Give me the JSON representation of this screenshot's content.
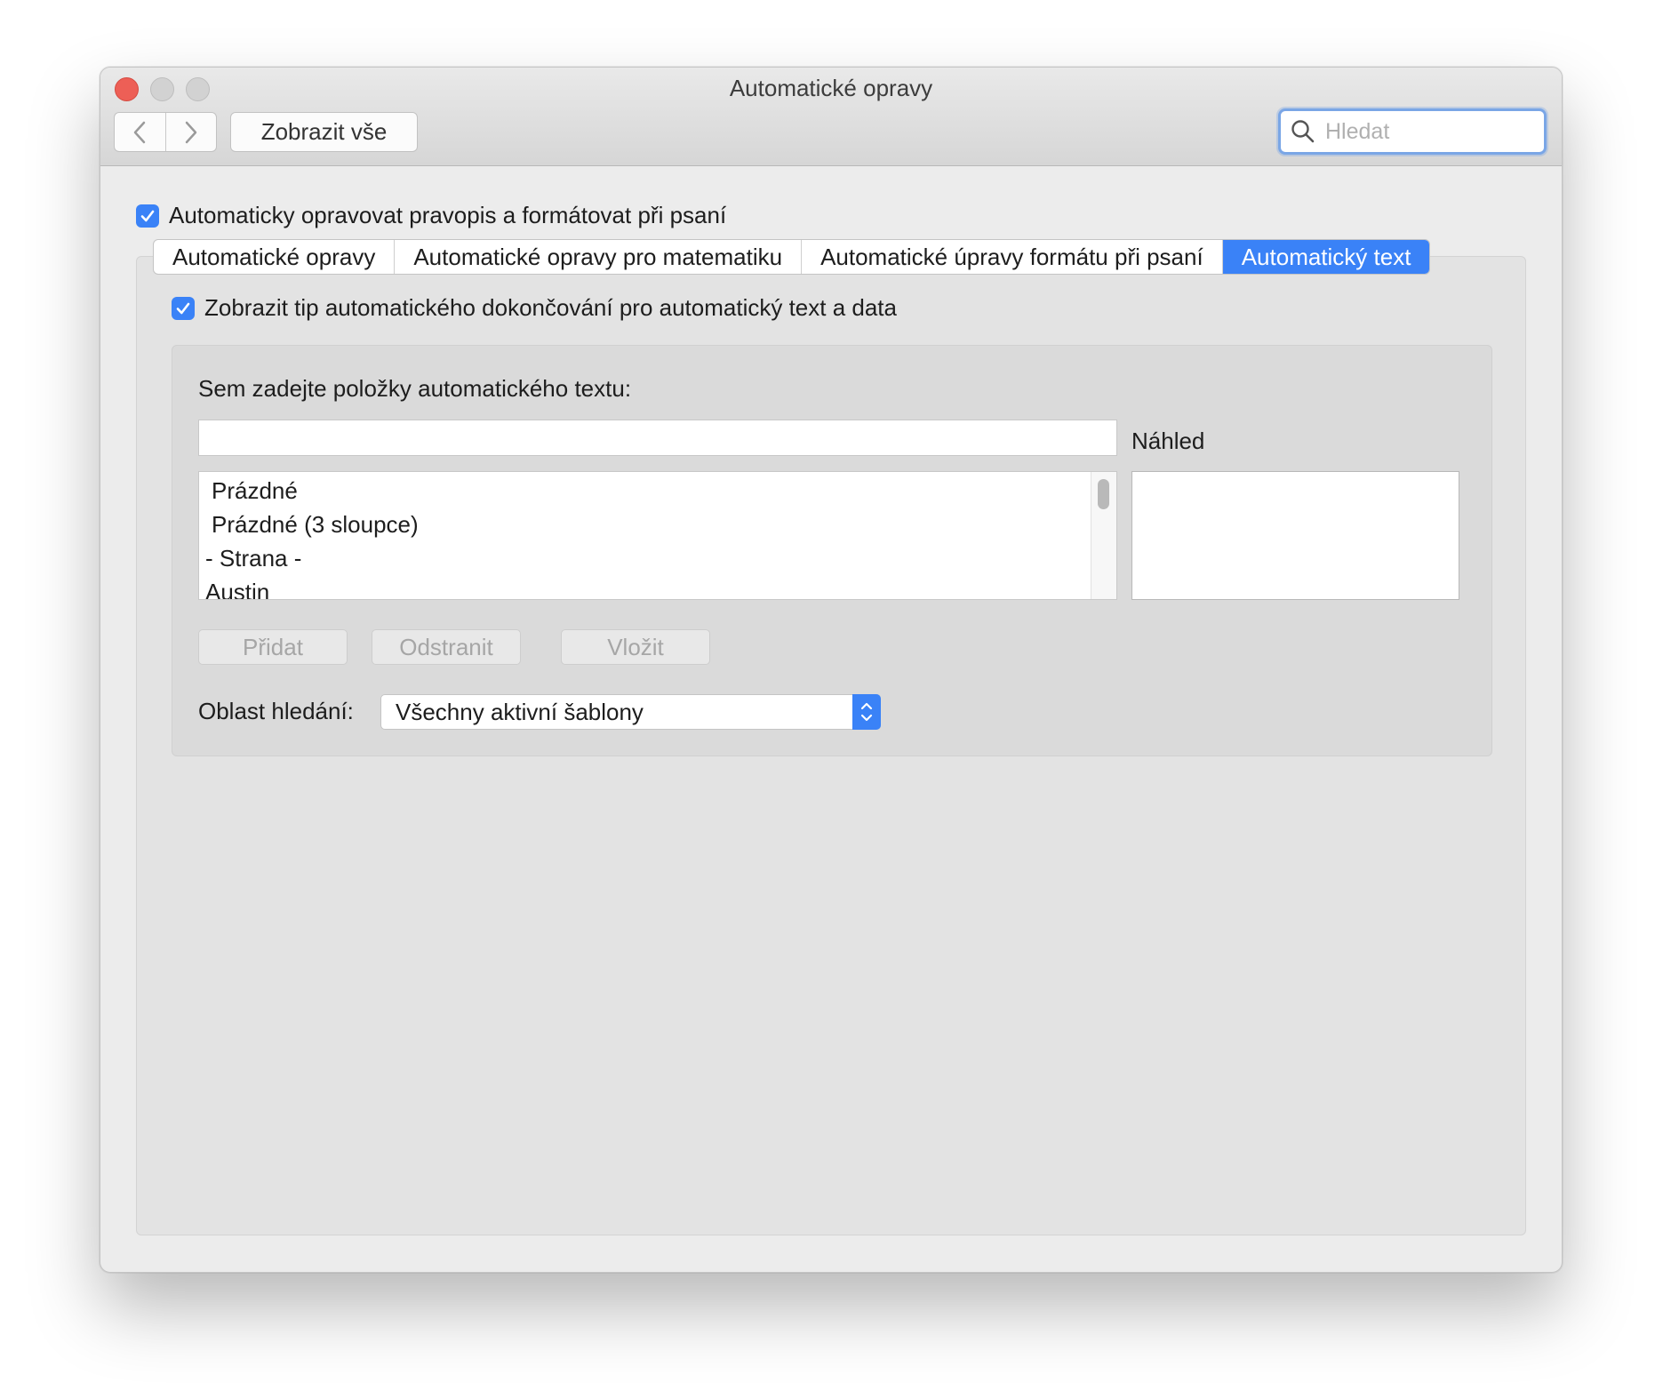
{
  "window": {
    "title": "Automatické opravy",
    "show_all_label": "Zobrazit vše",
    "search_placeholder": "Hledat"
  },
  "main": {
    "auto_correct_checkbox": {
      "label": "Automaticky opravovat pravopis a formátovat při psaní",
      "checked": true
    },
    "tabs": [
      {
        "label": "Automatické opravy",
        "active": false
      },
      {
        "label": "Automatické opravy pro matematiku",
        "active": false
      },
      {
        "label": "Automatické úpravy formátu při psaní",
        "active": false
      },
      {
        "label": "Automatický text",
        "active": true
      }
    ],
    "autocomplete_checkbox": {
      "label": "Zobrazit tip automatického dokončování pro automatický text a data",
      "checked": true
    },
    "entries_label": "Sem zadejte položky automatického textu:",
    "entry_value": "",
    "preview_label": "Náhled",
    "list_items": [
      "Prázdné",
      "Prázdné (3 sloupce)",
      "- Strana -",
      "Austin"
    ],
    "buttons": {
      "add": "Přidat",
      "remove": "Odstranit",
      "insert": "Vložit"
    },
    "search_scope_label": "Oblast hledání:",
    "search_scope_value": "Všechny aktivní šablony"
  },
  "colors": {
    "accent": "#3a82f7",
    "close_button": "#ed5f56"
  }
}
